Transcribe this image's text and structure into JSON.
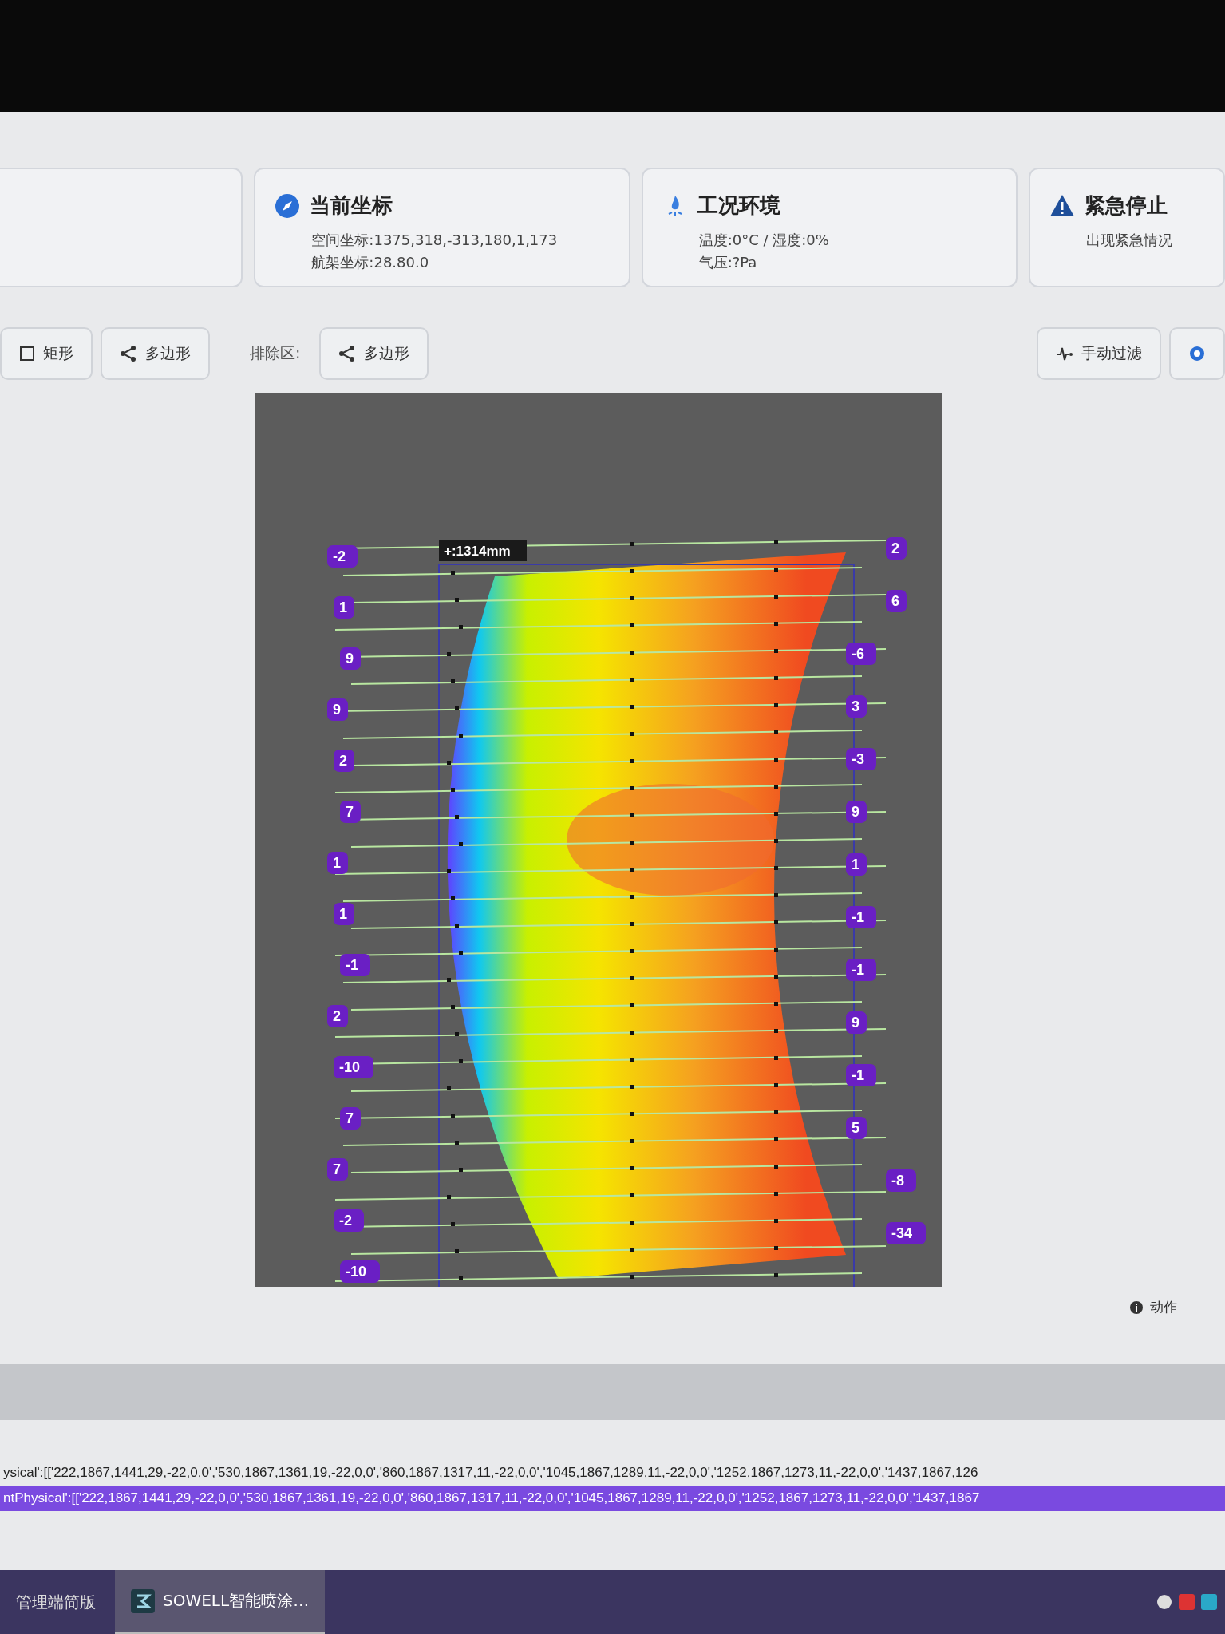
{
  "cards": [
    {
      "kind": "blank"
    },
    {
      "kind": "coordinates",
      "title": "当前坐标",
      "lines": [
        "空间坐标:1375,318,-313,180,1,173",
        "航架坐标:28.80.0"
      ]
    },
    {
      "kind": "environment",
      "title": "工况环境",
      "lines": [
        "温度:0°C / 湿度:0%",
        "气压:?Pa"
      ]
    },
    {
      "kind": "warning",
      "title": "紧急停止",
      "lines": [
        "出现紧急情况"
      ]
    }
  ],
  "toolbar": {
    "left": [
      {
        "kind": "rectangle",
        "label": "矩形"
      },
      {
        "kind": "polygon",
        "label": "多边形"
      }
    ],
    "exclusion_label": "排除区:",
    "exclusion": [
      {
        "kind": "polygon",
        "label": "多边形"
      }
    ],
    "right": [
      {
        "kind": "pulse",
        "label": "手动过滤"
      },
      {
        "kind": "circle"
      }
    ]
  },
  "heatmap": {
    "measurement": "+:1314mm",
    "left_labels": [
      "-2",
      "1",
      "9",
      "9",
      "2",
      "7",
      "1",
      "1",
      "-1",
      "2",
      "-10",
      "7",
      "7",
      "-2",
      "-10"
    ],
    "right_labels": [
      "2",
      "6",
      "-6",
      "3",
      "-3",
      "9",
      "1",
      "-1",
      "-1",
      "9",
      "-1",
      "5",
      "-8",
      "-34"
    ]
  },
  "status": {
    "action": "动作"
  },
  "log_lines": [
    {
      "text": "ysical':[['222,1867,1441,29,-22,0,0','530,1867,1361,19,-22,0,0','860,1867,1317,11,-22,0,0','1045,1867,1289,11,-22,0,0','1252,1867,1273,11,-22,0,0','1437,1867,126",
      "selected": false
    },
    {
      "text": "ntPhysical':[['222,1867,1441,29,-22,0,0','530,1867,1361,19,-22,0,0','860,1867,1317,11,-22,0,0','1045,1867,1289,11,-22,0,0','1252,1867,1273,11,-22,0,0','1437,1867",
      "selected": true
    }
  ],
  "taskbar": {
    "items": [
      {
        "label": "管理端简版",
        "selected": false
      },
      {
        "label": "SOWELL智能喷涂…",
        "selected": true
      }
    ]
  }
}
